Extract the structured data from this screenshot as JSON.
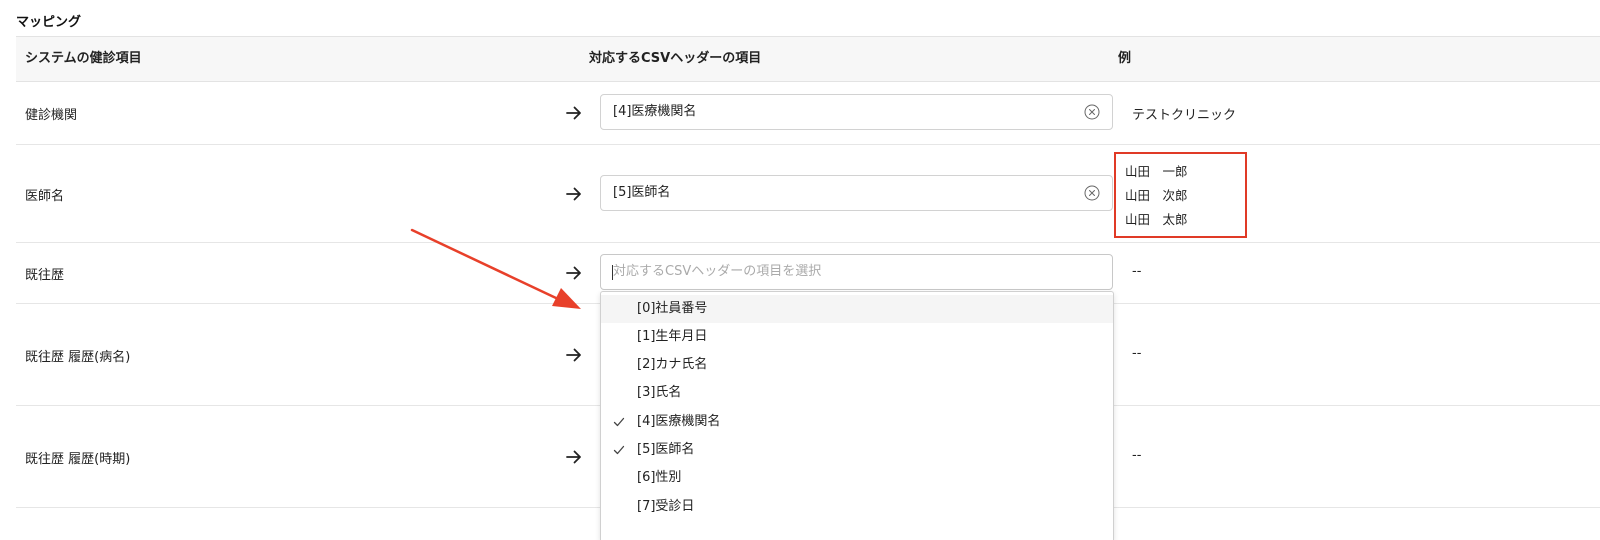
{
  "section_title": "マッピング",
  "table": {
    "headers": {
      "system_item": "システムの健診項目",
      "csv_header": "対応するCSVヘッダーの項目",
      "example": "例"
    },
    "rows": [
      {
        "label": "健診機関",
        "selected": "[4]医療機関名",
        "example": "テストクリニック"
      },
      {
        "label": "医師名",
        "selected": "[5]医師名",
        "example_lines": [
          "山田　一郎",
          "山田　次郎",
          "山田　太郎"
        ]
      },
      {
        "label": "既往歴",
        "placeholder": "対応するCSVヘッダーの項目を選択",
        "example": "--"
      },
      {
        "label": "既往歴 履歴(病名)",
        "example": "--"
      },
      {
        "label": "既往歴 履歴(時期)",
        "example": "--"
      }
    ]
  },
  "dropdown": {
    "options": [
      {
        "label": "[0]社員番号",
        "checked": false,
        "hover": true
      },
      {
        "label": "[1]生年月日",
        "checked": false
      },
      {
        "label": "[2]カナ氏名",
        "checked": false
      },
      {
        "label": "[3]氏名",
        "checked": false
      },
      {
        "label": "[4]医療機関名",
        "checked": true
      },
      {
        "label": "[5]医師名",
        "checked": true
      },
      {
        "label": "[6]性別",
        "checked": false
      },
      {
        "label": "[7]受診日",
        "checked": false
      }
    ]
  },
  "colors": {
    "highlight_red": "#e03a26"
  },
  "icons": {
    "row_arrow": "arrow-right-icon",
    "clear": "clear-circle-icon",
    "check": "check-icon",
    "annotation": "red-annotation-arrow"
  }
}
